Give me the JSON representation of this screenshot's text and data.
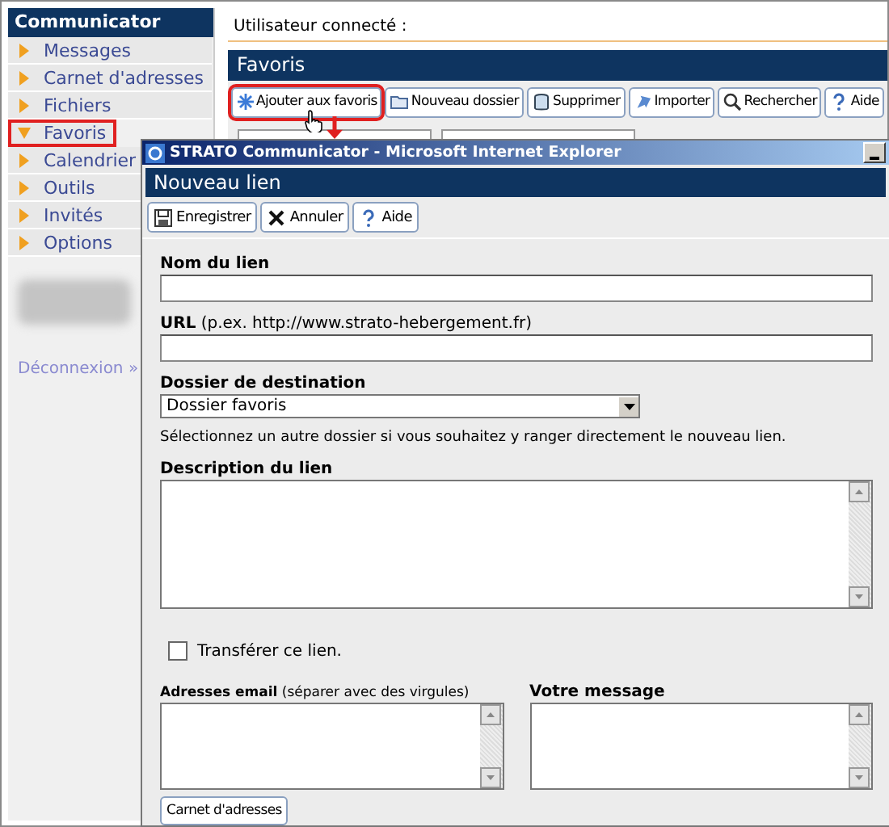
{
  "sidebar": {
    "title": "Communicator",
    "items": [
      {
        "label": "Messages",
        "selected": false
      },
      {
        "label": "Carnet d'adresses",
        "selected": false
      },
      {
        "label": "Fichiers",
        "selected": false
      },
      {
        "label": "Favoris",
        "selected": true
      },
      {
        "label": "Calendrier",
        "selected": false
      },
      {
        "label": "Outils",
        "selected": false
      },
      {
        "label": "Invités",
        "selected": false
      },
      {
        "label": "Options",
        "selected": false
      }
    ],
    "logout_link": "Déconnexion »"
  },
  "main": {
    "user_label": "Utilisateur connecté :",
    "section_title": "Favoris",
    "toolbar": [
      {
        "label": "Ajouter aux favoris",
        "highlighted": true
      },
      {
        "label": "Nouveau dossier",
        "highlighted": false
      },
      {
        "label": "Supprimer",
        "highlighted": false
      },
      {
        "label": "Importer",
        "highlighted": false
      },
      {
        "label": "Rechercher",
        "highlighted": false
      },
      {
        "label": "Aide",
        "highlighted": false
      }
    ]
  },
  "popup": {
    "window_title": "STRATO Communicator - Microsoft Internet Explorer",
    "heading": "Nouveau lien",
    "toolbar": [
      {
        "label": "Enregistrer"
      },
      {
        "label": "Annuler"
      },
      {
        "label": "Aide"
      }
    ],
    "name_field": {
      "label": "Nom du lien"
    },
    "url_field": {
      "label": "**URL** (p.ex. http://www.strato-hebergement.fr)"
    },
    "folder_select": {
      "label": "Dossier de destination",
      "value": "Dossier favoris",
      "help": "Sélectionnez un autre dossier si vous souhaitez y ranger directement le nouveau lien."
    },
    "description_field": {
      "label": "Description du lien"
    },
    "forward_checkbox": {
      "label": "Transférer ce lien.",
      "checked": false
    },
    "emails_field": {
      "label": "**Adresses email** (séparer avec des virgules)"
    },
    "message_field": {
      "label": "Votre message"
    },
    "address_book_button": "Carnet d'adresses"
  }
}
